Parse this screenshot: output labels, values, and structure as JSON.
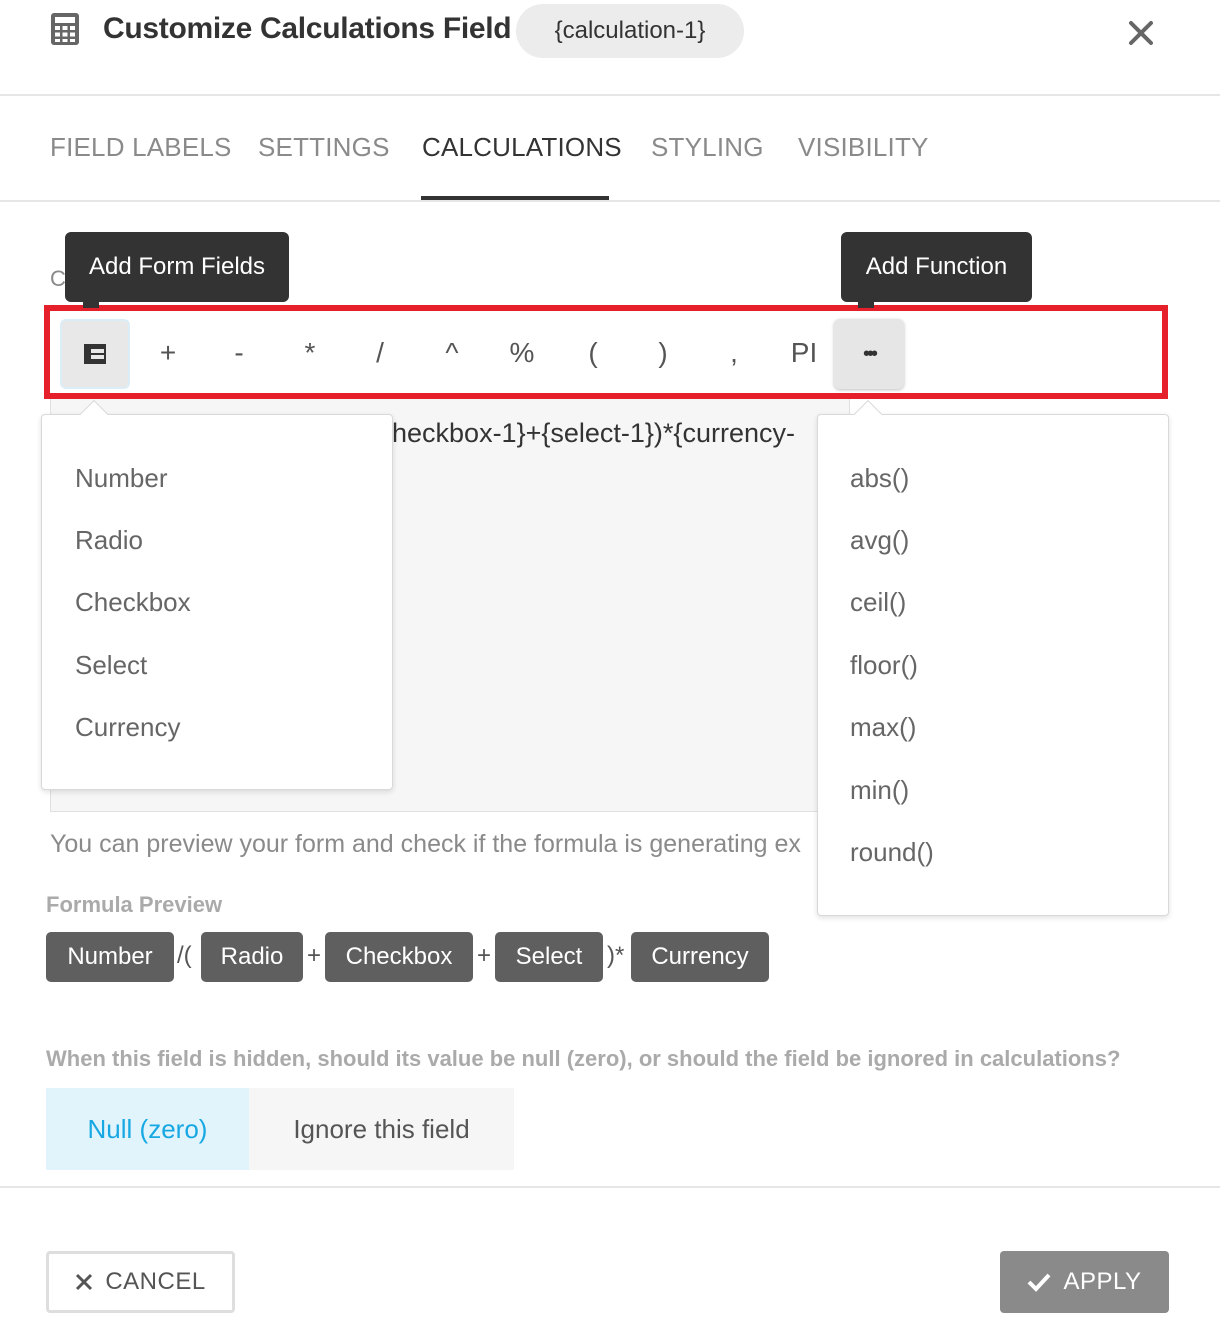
{
  "header": {
    "title": "Customize Calculations Field",
    "field_tag": "{calculation-1}",
    "icon": "calculator-icon",
    "close_icon": "close-icon"
  },
  "tabs": [
    {
      "label": "FIELD LABELS",
      "active": false
    },
    {
      "label": "SETTINGS",
      "active": false
    },
    {
      "label": "CALCULATIONS",
      "active": true
    },
    {
      "label": "STYLING",
      "active": false
    },
    {
      "label": "VISIBILITY",
      "active": false
    }
  ],
  "calculations": {
    "hidden_label_fragment": "C",
    "tooltips": {
      "add_form_fields": "Add Form Fields",
      "add_function": "Add Function"
    },
    "toolbar": {
      "fields_button_icon": "table-icon",
      "operators": [
        "+",
        "-",
        "*",
        "/",
        "^",
        "%",
        "(",
        ")",
        ",",
        "PI"
      ],
      "function_button_label": "•••"
    },
    "formula_visible_text": "heckbox-1}+{select-1})*{currency-",
    "field_menu": [
      "Number",
      "Radio",
      "Checkbox",
      "Select",
      "Currency"
    ],
    "function_menu": [
      "abs()",
      "avg()",
      "ceil()",
      "floor()",
      "max()",
      "min()",
      "round()"
    ],
    "hint": "You can preview your form and check if the formula is generating ex",
    "preview": {
      "label": "Formula Preview",
      "tokens": [
        {
          "type": "chip",
          "text": "Number"
        },
        {
          "type": "sym",
          "text": "/("
        },
        {
          "type": "chip",
          "text": "Radio"
        },
        {
          "type": "sym",
          "text": "+"
        },
        {
          "type": "chip",
          "text": "Checkbox"
        },
        {
          "type": "sym",
          "text": "+"
        },
        {
          "type": "chip",
          "text": "Select"
        },
        {
          "type": "sym",
          "text": ")*"
        },
        {
          "type": "chip",
          "text": "Currency"
        }
      ]
    },
    "hidden_question": "When this field is hidden, should its value be null (zero), or should the field be ignored in calculations?",
    "hidden_options": [
      {
        "label": "Null (zero)",
        "selected": true
      },
      {
        "label": "Ignore this field",
        "selected": false
      }
    ]
  },
  "footer": {
    "cancel_label": "CANCEL",
    "apply_label": "APPLY"
  },
  "colors": {
    "accent": "#17a8e3",
    "highlight_border": "#e5202a",
    "chip_bg": "#5f5f5f",
    "apply_bg": "#8a8a8a"
  }
}
